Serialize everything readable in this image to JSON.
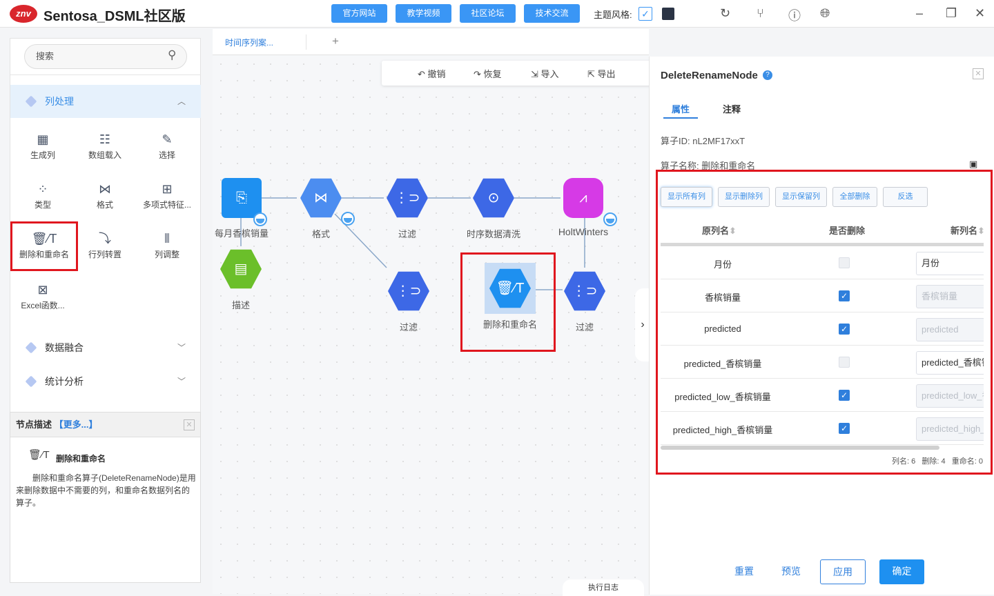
{
  "app": {
    "logo": "znv",
    "title": "Sentosa_DSML社区版",
    "links": [
      "官方网站",
      "教学视频",
      "社区论坛",
      "技术交流"
    ],
    "theme_label": "主题风格:",
    "icons": [
      "refresh-icon",
      "branch-icon",
      "help-icon",
      "globe-icon",
      "minimize-icon",
      "restore-icon",
      "close-icon"
    ]
  },
  "sidebar": {
    "search_placeholder": "搜索",
    "category_open": "列处理",
    "operators": [
      "生成列",
      "数组载入",
      "选择",
      "类型",
      "格式",
      "多项式特征...",
      "删除和重命名",
      "行列转置",
      "列调整",
      "Excel函数..."
    ],
    "categories": [
      "数据融合",
      "统计分析"
    ]
  },
  "desc": {
    "title": "节点描述",
    "more": "【更多...】",
    "node_name": "删除和重命名",
    "text": "删除和重命名算子(DeleteRenameNode)是用来删除数据中不需要的列，和重命名数据列名的算子。"
  },
  "tabs": {
    "active": "时间序列案...",
    "add": "+"
  },
  "toolbar": {
    "undo": "撤销",
    "redo": "恢复",
    "import": "导入",
    "export": "导出"
  },
  "nodes": {
    "source": "每月香槟销量",
    "format": "格式",
    "filter1": "过滤",
    "clean": "时序数据清洗",
    "hw": "HoltWinters",
    "describe": "描述",
    "filter2": "过滤",
    "delrename": "删除和重命名",
    "filter3": "过滤"
  },
  "exec_log": "执行日志",
  "panel": {
    "title": "DeleteRenameNode",
    "tabs": [
      "属性",
      "注释"
    ],
    "id_label": "算子ID:",
    "id_value": "nL2MF17xxT",
    "name_label": "算子名称:",
    "name_value": "删除和重命名",
    "filters": [
      "显示所有列",
      "显示删除列",
      "显示保留列",
      "全部删除",
      "反选"
    ],
    "columns": [
      "原列名",
      "是否删除",
      "新列名"
    ],
    "rows": [
      {
        "orig": "月份",
        "deleted": false,
        "new": "月份"
      },
      {
        "orig": "香槟销量",
        "deleted": true,
        "new": "香槟销量"
      },
      {
        "orig": "predicted",
        "deleted": true,
        "new": "predicted"
      },
      {
        "orig": "predicted_香槟销量",
        "deleted": false,
        "new": "predicted_香槟销量"
      },
      {
        "orig": "predicted_low_香槟销量",
        "deleted": true,
        "new": "predicted_low_香槟销量"
      },
      {
        "orig": "predicted_high_香槟销量",
        "deleted": true,
        "new": "predicted_high_香槟销量"
      }
    ],
    "summary": "列名: 6   删除: 4   重命名: 0",
    "buttons": {
      "reset": "重置",
      "preview": "预览",
      "apply": "应用",
      "ok": "确定"
    }
  },
  "colors": {
    "accent": "#3a96f5",
    "highlight": "#e0161e"
  }
}
